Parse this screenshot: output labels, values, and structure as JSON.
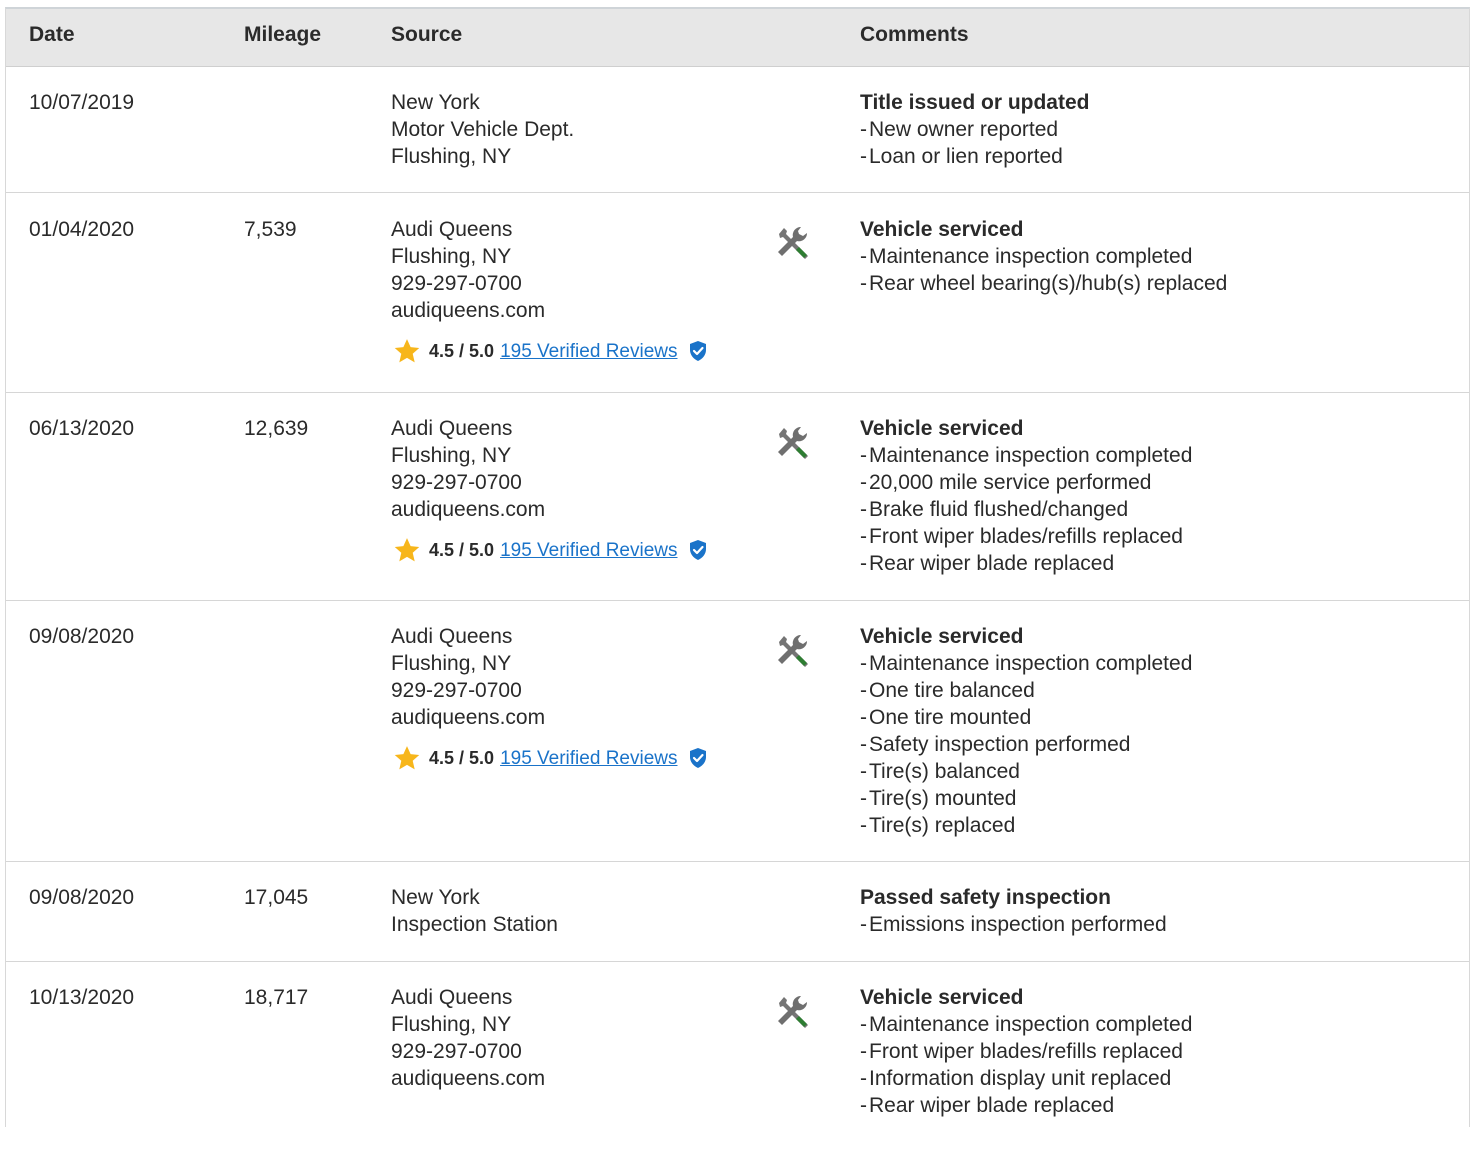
{
  "headers": {
    "date": "Date",
    "mileage": "Mileage",
    "source": "Source",
    "comments": "Comments"
  },
  "colors": {
    "accent_link": "#1a73c9",
    "star": "#f7b61b",
    "shield": "#1a73c9",
    "wrench_gray": "#757575",
    "wrench_green": "#2e7d32",
    "header_bg": "#e7e7e7"
  },
  "rows": [
    {
      "date": "10/07/2019",
      "mileage": "",
      "source": [
        "New York",
        "Motor Vehicle Dept.",
        "Flushing, NY"
      ],
      "comment_title": "Title issued or updated",
      "comment_items": [
        "New owner reported",
        "Loan or lien reported"
      ]
    },
    {
      "date": "01/04/2020",
      "mileage": "7,539",
      "source": [
        "Audi Queens",
        "Flushing, NY",
        "929-297-0700",
        "audiqueens.com"
      ],
      "rating": "4.5 / 5.0",
      "reviews": "195 Verified Reviews",
      "icon": "wrench-screwdriver-icon",
      "comment_title": "Vehicle serviced",
      "comment_items": [
        "Maintenance inspection completed",
        "Rear wheel bearing(s)/hub(s) replaced"
      ]
    },
    {
      "date": "06/13/2020",
      "mileage": "12,639",
      "source": [
        "Audi Queens",
        "Flushing, NY",
        "929-297-0700",
        "audiqueens.com"
      ],
      "rating": "4.5 / 5.0",
      "reviews": "195 Verified Reviews",
      "icon": "wrench-screwdriver-icon",
      "comment_title": "Vehicle serviced",
      "comment_items": [
        "Maintenance inspection completed",
        "20,000 mile service performed",
        "Brake fluid flushed/changed",
        "Front wiper blades/refills replaced",
        "Rear wiper blade replaced"
      ]
    },
    {
      "date": "09/08/2020",
      "mileage": "",
      "source": [
        "Audi Queens",
        "Flushing, NY",
        "929-297-0700",
        "audiqueens.com"
      ],
      "rating": "4.5 / 5.0",
      "reviews": "195 Verified Reviews",
      "icon": "wrench-screwdriver-icon",
      "comment_title": "Vehicle serviced",
      "comment_items": [
        "Maintenance inspection completed",
        "One tire balanced",
        "One tire mounted",
        "Safety inspection performed",
        "Tire(s) balanced",
        "Tire(s) mounted",
        "Tire(s) replaced"
      ]
    },
    {
      "date": "09/08/2020",
      "mileage": "17,045",
      "source": [
        "New York",
        "Inspection Station"
      ],
      "comment_title": "Passed safety inspection",
      "comment_items": [
        "Emissions inspection performed"
      ]
    },
    {
      "date": "10/13/2020",
      "mileage": "18,717",
      "source": [
        "Audi Queens",
        "Flushing, NY",
        "929-297-0700",
        "audiqueens.com"
      ],
      "icon": "wrench-screwdriver-icon",
      "comment_title": "Vehicle serviced",
      "comment_items": [
        "Maintenance inspection completed",
        "Front wiper blades/refills replaced",
        "Information display unit replaced",
        "Rear wiper blade replaced"
      ]
    }
  ]
}
